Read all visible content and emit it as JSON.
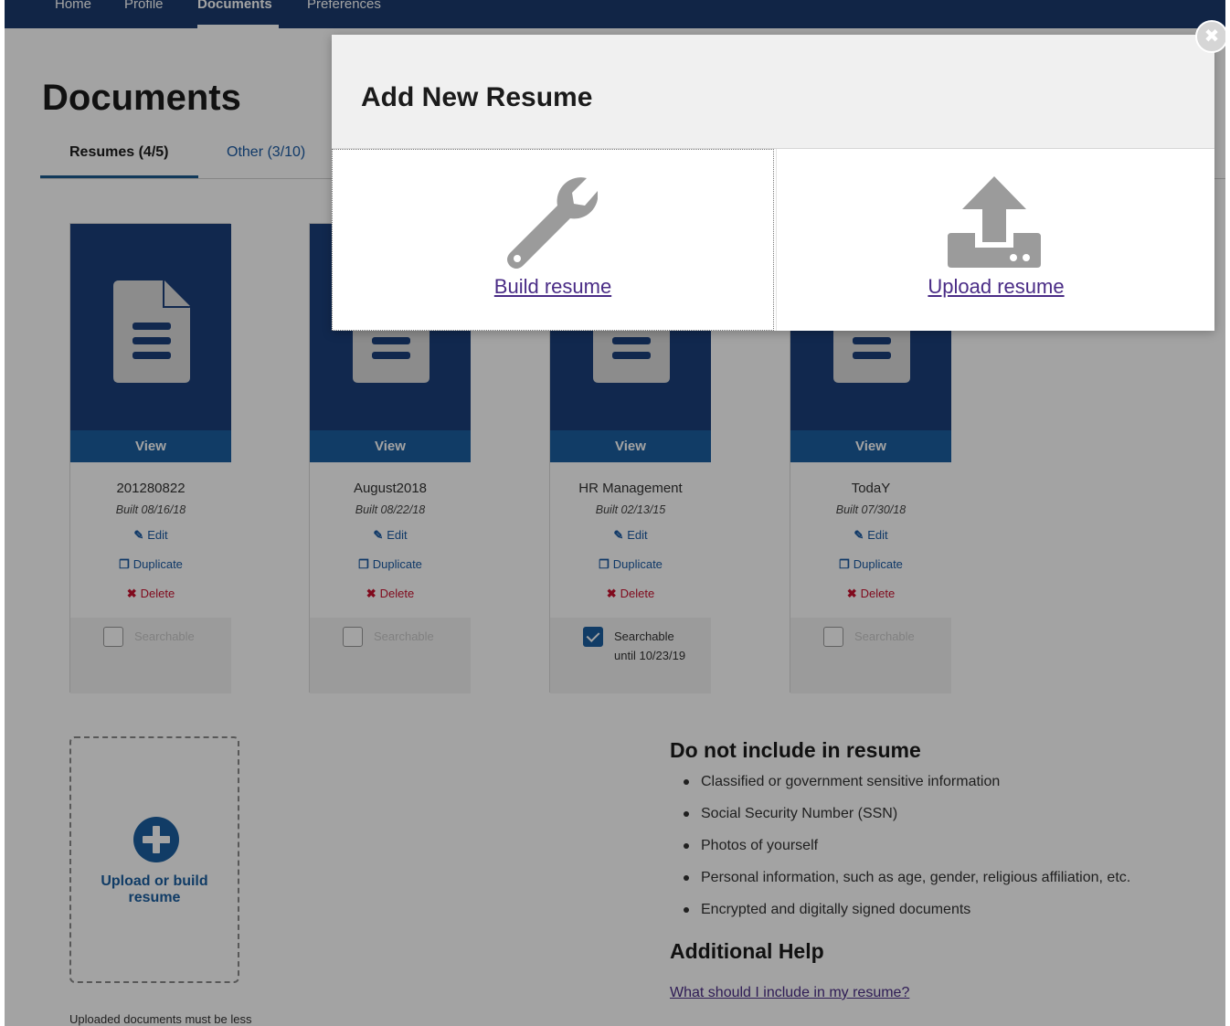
{
  "nav": {
    "items": [
      {
        "label": "Home",
        "active": false
      },
      {
        "label": "Profile",
        "active": false
      },
      {
        "label": "Documents",
        "active": true
      },
      {
        "label": "Preferences",
        "active": false
      }
    ]
  },
  "page": {
    "title": "Documents",
    "tabs": [
      {
        "label": "Resumes (4/5)",
        "active": true
      },
      {
        "label": "Other (3/10)",
        "active": false
      }
    ]
  },
  "resumes": [
    {
      "view_label": "View",
      "name": "201280822",
      "built": "Built 08/16/18",
      "edit": "Edit",
      "duplicate": "Duplicate",
      "delete": "Delete",
      "searchable_label": "Searchable",
      "searchable": false,
      "until": ""
    },
    {
      "view_label": "View",
      "name": "August2018",
      "built": "Built 08/22/18",
      "edit": "Edit",
      "duplicate": "Duplicate",
      "delete": "Delete",
      "searchable_label": "Searchable",
      "searchable": false,
      "until": ""
    },
    {
      "view_label": "View",
      "name": "HR Management",
      "built": "Built 02/13/15",
      "edit": "Edit",
      "duplicate": "Duplicate",
      "delete": "Delete",
      "searchable_label": "Searchable",
      "searchable": true,
      "until": "until 10/23/19"
    },
    {
      "view_label": "View",
      "name": "TodaY",
      "built": "Built 07/30/18",
      "edit": "Edit",
      "duplicate": "Duplicate",
      "delete": "Delete",
      "searchable_label": "Searchable",
      "searchable": false,
      "until": ""
    }
  ],
  "upload_tile": {
    "label_line1": "Upload or build",
    "label_line2": "resume",
    "note": "Uploaded documents must be less"
  },
  "guidance": {
    "heading": "Do not include in resume",
    "items": [
      "Classified or government sensitive information",
      "Social Security Number (SSN)",
      "Photos of yourself",
      "Personal information, such as age, gender, religious affiliation, etc.",
      "Encrypted and digitally signed documents"
    ],
    "help_heading": "Additional Help",
    "help_link": "What should I include in my resume?"
  },
  "modal": {
    "title": "Add New Resume",
    "build_label": "Build resume",
    "upload_label": "Upload resume",
    "close_glyph": "✖"
  },
  "colors": {
    "navy": "#1b3b6e",
    "card_blue": "#1b3f7a",
    "view_blue": "#1b5fa0",
    "link_blue": "#1a5aa3",
    "visited_purple": "#4a2c86",
    "delete_red": "#c8102e",
    "icon_gray": "#dcdcdc"
  },
  "icons": {
    "document": "document-icon",
    "edit": "edit-icon",
    "duplicate": "duplicate-icon",
    "delete": "delete-x-icon",
    "plus": "plus-circle-icon",
    "wrench": "wrench-icon",
    "upload": "upload-tray-icon",
    "close": "close-icon"
  }
}
